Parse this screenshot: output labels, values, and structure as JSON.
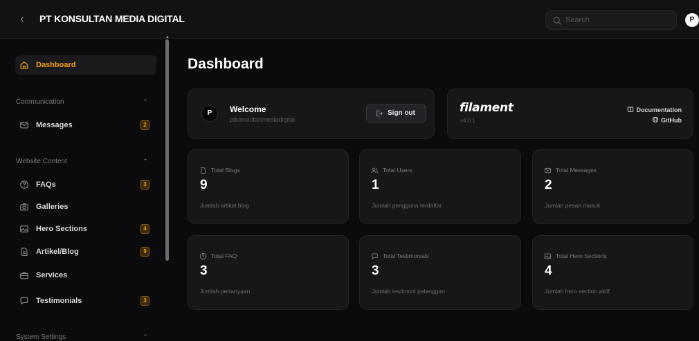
{
  "topbar": {
    "brand": "PT KONSULTAN MEDIA DIGITAL",
    "search_placeholder": "Search",
    "avatar_initial": "P"
  },
  "sidebar": {
    "dashboard": {
      "label": "Dashboard",
      "icon": "home-icon"
    },
    "groups": [
      {
        "label": "Communication",
        "items": [
          {
            "label": "Messages",
            "badge": "2",
            "icon": "envelope-icon"
          }
        ]
      },
      {
        "label": "Website Content",
        "items": [
          {
            "label": "FAQs",
            "badge": "3",
            "icon": "question-circle-icon"
          },
          {
            "label": "Galleries",
            "badge": "",
            "icon": "camera-icon"
          },
          {
            "label": "Hero Sections",
            "badge": "4",
            "icon": "photo-icon"
          },
          {
            "label": "Artikel/Blog",
            "badge": "9",
            "icon": "document-icon"
          },
          {
            "label": "Services",
            "badge": "",
            "icon": "briefcase-icon"
          },
          {
            "label": "Testimonials",
            "badge": "3",
            "icon": "chat-bubble-icon"
          }
        ]
      },
      {
        "label": "System Settings",
        "items": []
      }
    ]
  },
  "main": {
    "title": "Dashboard",
    "welcome": {
      "avatar_initial": "P",
      "title": "Welcome",
      "subtitle": "ptkonsultanmediadigital",
      "signout_label": "Sign out"
    },
    "filament": {
      "logo": "filament",
      "version": "v4.0.1",
      "documentation_label": "Documentation",
      "github_label": "GitHub"
    },
    "stats": [
      {
        "title": "Total Blogs",
        "value": "9",
        "description": "Jumlah artikel blog",
        "icon": "document-icon"
      },
      {
        "title": "Total Users",
        "value": "1",
        "description": "Jumlah pengguna terdaftar",
        "icon": "users-icon"
      },
      {
        "title": "Total Messages",
        "value": "2",
        "description": "Jumlah pesan masuk",
        "icon": "envelope-icon"
      },
      {
        "title": "Total FAQ",
        "value": "3",
        "description": "Jumlah pertanyaan",
        "icon": "question-circle-icon"
      },
      {
        "title": "Total Testimonials",
        "value": "3",
        "description": "Jumlah testimoni pelanggan",
        "icon": "chat-bubble-icon"
      },
      {
        "title": "Total Hero Sections",
        "value": "4",
        "description": "Jumlah hero section aktif",
        "icon": "photo-icon"
      }
    ]
  },
  "colors": {
    "accent": "#f59e0b",
    "background": "#0b0b0d",
    "card": "#17171a"
  }
}
